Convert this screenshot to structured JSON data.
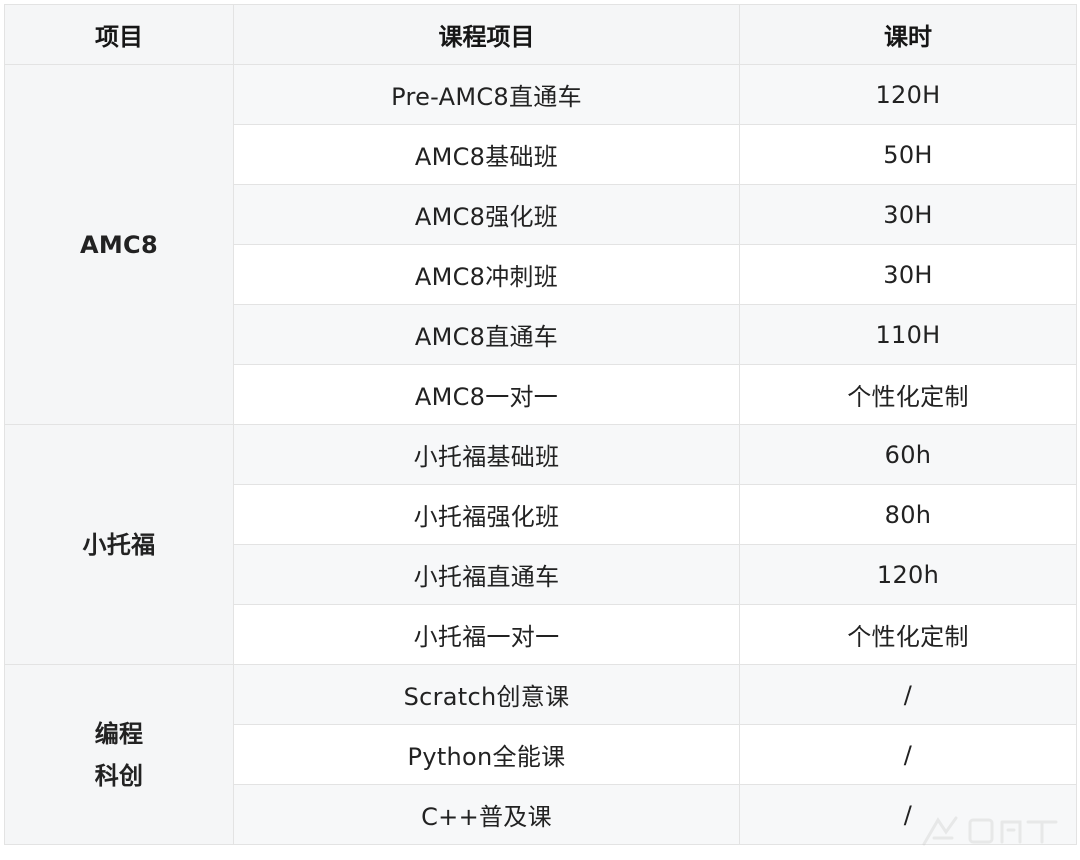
{
  "table": {
    "headers": [
      "项目",
      "课程项目",
      "课时"
    ],
    "groups": [
      {
        "project_lines": [
          "AMC8"
        ],
        "rows": [
          {
            "course": "Pre-AMC8直通车",
            "hours": "120H"
          },
          {
            "course": "AMC8基础班",
            "hours": "50H"
          },
          {
            "course": "AMC8强化班",
            "hours": "30H"
          },
          {
            "course": "AMC8冲刺班",
            "hours": "30H"
          },
          {
            "course": "AMC8直通车",
            "hours": "110H"
          },
          {
            "course": "AMC8一对一",
            "hours": "个性化定制"
          }
        ]
      },
      {
        "project_lines": [
          "小托福"
        ],
        "rows": [
          {
            "course": "小托福基础班",
            "hours": "60h"
          },
          {
            "course": "小托福强化班",
            "hours": "80h"
          },
          {
            "course": "小托福直通车",
            "hours": "120h"
          },
          {
            "course": "小托福一对一",
            "hours": "个性化定制"
          }
        ]
      },
      {
        "project_lines": [
          "编程",
          "科创"
        ],
        "rows": [
          {
            "course": "Scratch创意课",
            "hours": "/"
          },
          {
            "course": "Python全能课",
            "hours": "/"
          },
          {
            "course": "C++普及课",
            "hours": "/"
          }
        ]
      }
    ]
  }
}
